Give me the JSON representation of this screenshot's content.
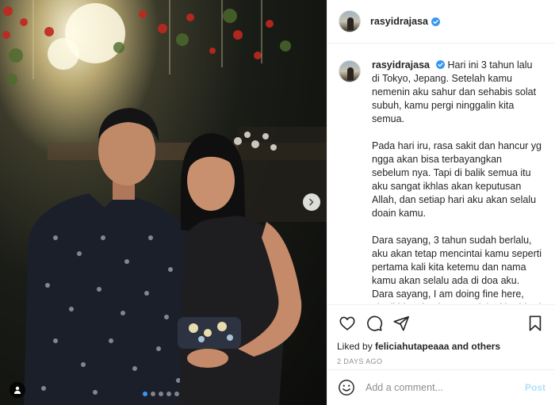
{
  "post": {
    "username": "rasyidrajasa",
    "verified": true,
    "caption": {
      "username": "rasyidrajasa",
      "paragraphs": [
        "Hari ini 3 tahun lalu di Tokyo, Jepang. Setelah kamu nemenin aku sahur dan sehabis solat subuh, kamu pergi ninggalin kita semua.",
        "Pada hari iru, rasa sakit dan hancur yg ngga akan bisa terbayangkan sebelum nya. Tapi di balik semua itu aku sangat ikhlas akan keputusan Allah, dan setiap hari aku akan selalu doain kamu.",
        "Dara sayang, 3 tahun sudah berlalu, aku akan tetap mencintai kamu seperti pertama kali kita ketemu dan nama kamu akan selalu ada di doa aku. Dara sayang, I am doing fine here, aku ikhlas dan kuat menjalani hari-hari seperti yg kamu mau dan"
      ]
    },
    "likes": {
      "prefix": "Liked by",
      "user": "feliciahutapeaaa",
      "suffix": "and others"
    },
    "time_ago": "2 DAYS AGO",
    "carousel": {
      "total": 5,
      "active": 1
    }
  },
  "comment": {
    "placeholder": "Add a comment...",
    "post_label": "Post"
  },
  "icons": {
    "like": "heart-icon",
    "comment": "comment-icon",
    "share": "share-icon",
    "save": "bookmark-icon",
    "emoji": "smiley-icon",
    "next": "chevron-right-icon",
    "tags": "user-tag-icon",
    "verified": "verified-badge-icon"
  },
  "colors": {
    "accent": "#3897f0",
    "verified": "#3897f0",
    "muted": "#8e8e8e",
    "post_disabled": "#b2dffc"
  }
}
